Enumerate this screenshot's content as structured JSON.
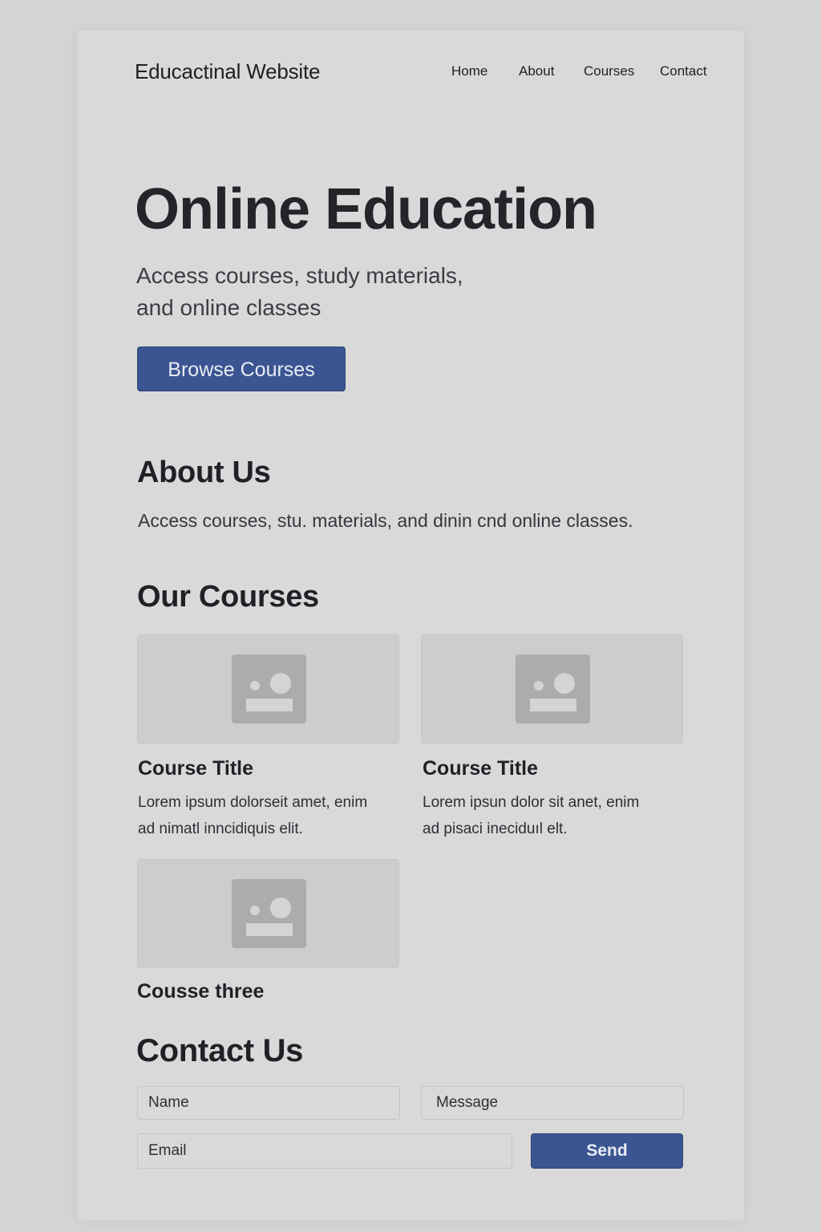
{
  "header": {
    "brand": "Educactinal Website",
    "nav": [
      "Home",
      "About",
      "Courses",
      "Contact"
    ]
  },
  "hero": {
    "title": "Online Education",
    "subtitle_lines": [
      "Access courses, study materials,",
      "and online classes"
    ],
    "cta_label": "Browse Courses"
  },
  "about": {
    "title": "About Us",
    "text": "Access courses, stu. materials,  and dinin cnd online classes."
  },
  "courses": {
    "title": "Our Courses",
    "items": [
      {
        "title": "Course Title",
        "desc_lines": [
          "Lorem ipsum dolorseit amet, enim",
          "ad nimatl inncidiquis elit."
        ],
        "image_icon": "image-placeholder-icon"
      },
      {
        "title": "Course Title",
        "desc_lines": [
          "Lorem ipsun dolor sit anet, enim",
          "ad pisaci ineciduıl elt."
        ],
        "image_icon": "image-placeholder-icon"
      },
      {
        "title": "Cousse three",
        "desc_lines": [],
        "image_icon": "image-placeholder-icon"
      }
    ]
  },
  "contact": {
    "title": "Contact Us",
    "name_placeholder": "Name",
    "message_placeholder": "Message",
    "email_placeholder": "Email",
    "send_label": "Send"
  },
  "colors": {
    "background": "#d4d4d4",
    "card": "#d9d9d9",
    "accent": "#3b5592",
    "text": "#1f2126"
  }
}
